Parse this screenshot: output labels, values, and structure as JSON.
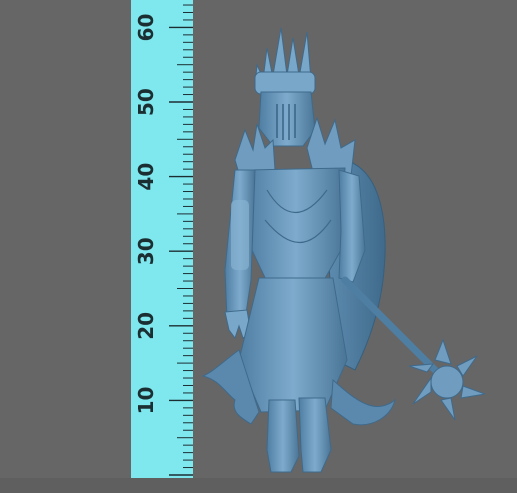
{
  "scene": {
    "ruler": {
      "unit_labels": [
        "10",
        "20",
        "30",
        "40",
        "50",
        "60"
      ],
      "colors": {
        "face": "#7fe7ee",
        "ticks": "#1b2f33"
      }
    },
    "model": {
      "subject": "armored dark-lord figurine with spiked crown, cape and spiked mace",
      "colors": {
        "body": "#6f9cbf",
        "shadow": "#4a7596",
        "highlight": "#a9cce6"
      }
    },
    "background": "#666667"
  }
}
